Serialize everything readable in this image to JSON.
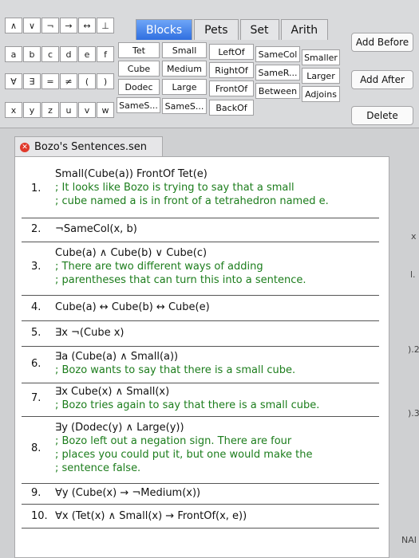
{
  "symbols": {
    "row1": [
      "∧",
      "∨",
      "¬",
      "→",
      "↔",
      "⊥"
    ],
    "row2": [
      "a",
      "b",
      "c",
      "d",
      "e",
      "f"
    ],
    "row3": [
      "∀",
      "∃",
      "=",
      "≠",
      "(",
      ")"
    ],
    "row4": [
      "x",
      "y",
      "z",
      "u",
      "v",
      "w"
    ]
  },
  "tabs": [
    {
      "label": "Blocks",
      "active": true
    },
    {
      "label": "Pets",
      "active": false
    },
    {
      "label": "Set",
      "active": false
    },
    {
      "label": "Arith",
      "active": false
    }
  ],
  "predicates": {
    "row1": [
      "Tet",
      "Small",
      "LeftOf",
      "SameCol",
      "Smaller"
    ],
    "row2": [
      "Cube",
      "Medium",
      "RightOf",
      "SameR...",
      "Larger"
    ],
    "row3": [
      "Dodec",
      "Large",
      "FrontOf",
      "Between",
      "Adjoins"
    ],
    "row4": [
      "SameS...",
      "SameS...",
      "BackOf"
    ]
  },
  "actions": {
    "add_before": "Add Before",
    "add_after": "Add After",
    "delete": "Delete"
  },
  "document": {
    "title": "Bozo's Sentences.sen",
    "sentences": [
      {
        "number": "1.",
        "lines": [
          {
            "text": "Small(Cube(a)) FrontOf Tet(e)",
            "comment": false
          },
          {
            "text": "; It looks like Bozo is trying to say that a small",
            "comment": true
          },
          {
            "text": "; cube named a is in front of a tetrahedron named e.",
            "comment": true
          }
        ]
      },
      {
        "number": "2.",
        "lines": [
          {
            "text": "¬SameCol(x, b)",
            "comment": false
          }
        ]
      },
      {
        "number": "3.",
        "lines": [
          {
            "text": "Cube(a) ∧ Cube(b) ∨ Cube(c)",
            "comment": false
          },
          {
            "text": "; There are two different ways of adding",
            "comment": true
          },
          {
            "text": "; parentheses that can turn this into a sentence.",
            "comment": true
          }
        ]
      },
      {
        "number": "4.",
        "lines": [
          {
            "text": "Cube(a) ↔ Cube(b) ↔ Cube(e)",
            "comment": false
          }
        ]
      },
      {
        "number": "5.",
        "lines": [
          {
            "text": "∃x ¬(Cube x)",
            "comment": false
          }
        ]
      },
      {
        "number": "6.",
        "lines": [
          {
            "text": "∃a (Cube(a) ∧ Small(a))",
            "comment": false
          },
          {
            "text": "; Bozo wants to say that there is a small cube.",
            "comment": true
          }
        ]
      },
      {
        "number": "7.",
        "lines": [
          {
            "text": "∃x Cube(x) ∧ Small(x)",
            "comment": false
          },
          {
            "text": "; Bozo tries again to say that there is a small cube.",
            "comment": true
          }
        ]
      },
      {
        "number": "8.",
        "lines": [
          {
            "text": "∃y (Dodec(y) ∧ Large(y))",
            "comment": false
          },
          {
            "text": "; Bozo left out a negation sign.  There are four",
            "comment": true
          },
          {
            "text": "; places you could put it, but one would make the",
            "comment": true
          },
          {
            "text": "; sentence false.",
            "comment": true
          }
        ]
      },
      {
        "number": "9.",
        "lines": [
          {
            "text": "∀y (Cube(x) → ¬Medium(x))",
            "comment": false
          }
        ]
      },
      {
        "number": "10.",
        "lines": [
          {
            "text": "∀x (Tet(x) ∧ Small(x) → FrontOf(x, e))",
            "comment": false
          }
        ]
      }
    ]
  },
  "edge_glimpses": {
    "e1": "x",
    "e2": "l.",
    "e3": ").2",
    "e4": ").3",
    "e5": "NAI"
  }
}
